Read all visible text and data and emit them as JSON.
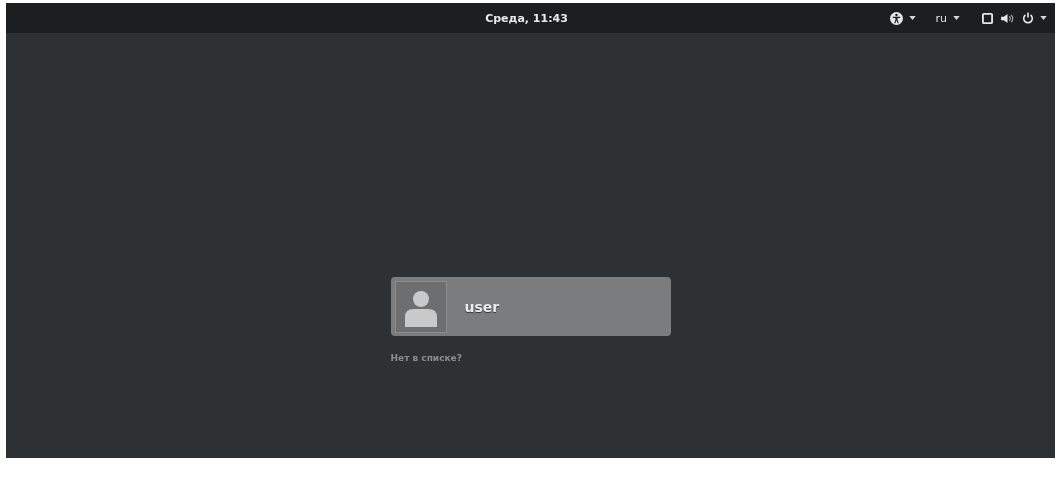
{
  "top_bar": {
    "clock": "Среда, 11:43",
    "keyboard_layout": "ru"
  },
  "user_list": [
    {
      "name": "user"
    }
  ],
  "not_listed_link": "Нет в списке?"
}
